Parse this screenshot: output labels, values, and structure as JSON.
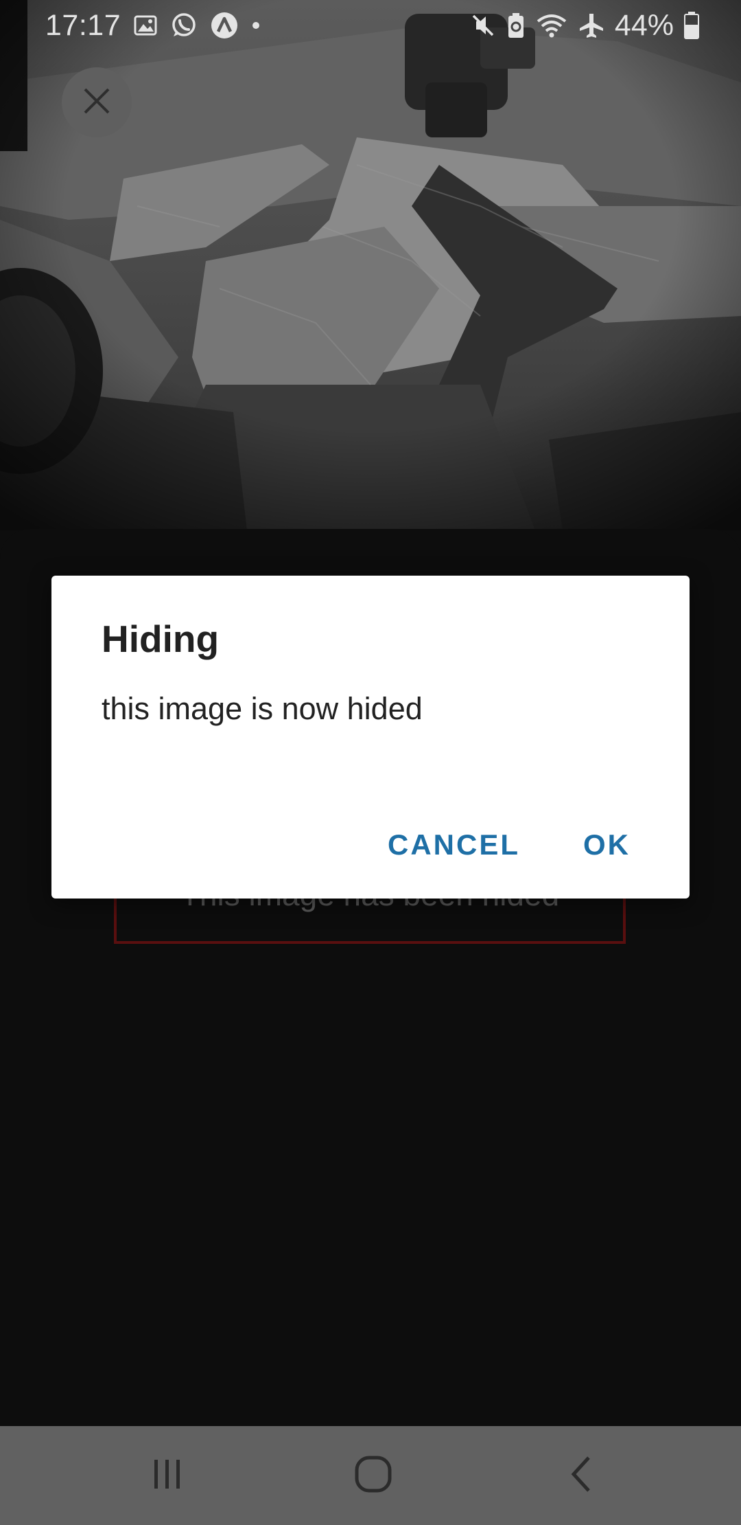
{
  "status_bar": {
    "time": "17:17",
    "battery_percent": "44%",
    "left_icons": [
      "gallery-icon",
      "whatsapp-icon",
      "app-icon",
      "dot-icon"
    ],
    "right_icons": [
      "mute-icon",
      "battery-saver-icon",
      "wifi-icon",
      "airplane-icon",
      "battery-icon"
    ]
  },
  "viewer": {
    "close_icon": "close-icon",
    "hidden_notice": "This image has been hided"
  },
  "dialog": {
    "title": "Hiding",
    "message": "this image is now hided",
    "cancel_label": "CANCEL",
    "ok_label": "OK",
    "button_color": "#1e6fa6"
  },
  "nav_bar": {
    "icons": [
      "recents-icon",
      "home-icon",
      "back-icon"
    ]
  },
  "colors": {
    "background": "#0d0d0d",
    "nav_bar": "#616161",
    "notice_border": "#5a0f0f"
  }
}
